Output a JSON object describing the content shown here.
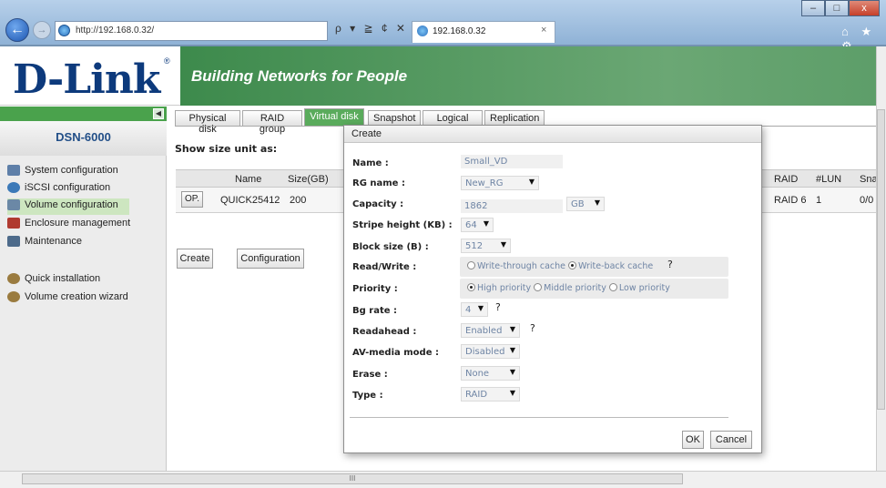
{
  "browser": {
    "address": "http://192.168.0.32/",
    "tab_title": "192.168.0.32",
    "tab_close": "×",
    "address_tools": "ρ ▾ ≧ ¢ ✕",
    "window_controls": {
      "minimize": "–",
      "maximize": "□",
      "close": "x"
    },
    "right_icons": "⌂ ★ ⚙",
    "hscroll_grip": "III"
  },
  "header": {
    "logo": "D-Link",
    "logo_reg": "®",
    "slogan": "Building Networks for People"
  },
  "sidebar": {
    "collapse": "◀",
    "model": "DSN-6000",
    "items": [
      {
        "label": "System configuration",
        "icon": "system-config-icon",
        "color": "#5e7fa8"
      },
      {
        "label": "iSCSI configuration",
        "icon": "iscsi-globe-icon",
        "color": "#3c79b8"
      },
      {
        "label": "Volume configuration",
        "icon": "volume-icon",
        "color": "#6b88a6"
      },
      {
        "label": "Enclosure management",
        "icon": "enclosure-icon",
        "color": "#b03a30"
      },
      {
        "label": "Maintenance",
        "icon": "maintenance-icon",
        "color": "#4d6a8a"
      },
      {
        "label": "Quick installation",
        "icon": "quick-install-icon",
        "color": "#9a7b3f"
      },
      {
        "label": "Volume creation wizard",
        "icon": "wizard-icon",
        "color": "#9a7b3f"
      }
    ]
  },
  "tabs": [
    "Physical disk",
    "RAID group",
    "Virtual disk",
    "Snapshot",
    "Logical unit",
    "Replication"
  ],
  "active_tab": "Virtual disk",
  "show_size_unit": "Show size unit as:",
  "table": {
    "headers": {
      "name": "Name",
      "size": "Size(GB)",
      "raid": "RAID",
      "lun": "#LUN",
      "snap": "Sna"
    },
    "row": {
      "op": "OP.",
      "name": "QUICK25412",
      "size": "200",
      "raid": "RAID 6",
      "lun": "1",
      "snap": "0/0"
    }
  },
  "page_buttons": {
    "create": "Create",
    "configuration": "Configuration"
  },
  "dialog": {
    "title": "Create",
    "fields": {
      "name": {
        "label": "Name :",
        "value": "Small_VD"
      },
      "rg_name": {
        "label": "RG name :",
        "value": "New_RG"
      },
      "capacity": {
        "label": "Capacity :",
        "value": "1862",
        "unit": "GB"
      },
      "stripe": {
        "label": "Stripe height (KB) :",
        "value": "64"
      },
      "block": {
        "label": "Block size (B) :",
        "value": "512"
      },
      "rw": {
        "label": "Read/Write :",
        "opt1": "Write-through cache",
        "opt2": "Write-back cache"
      },
      "priority": {
        "label": "Priority :",
        "opt1": "High priority",
        "opt2": "Middle priority",
        "opt3": "Low priority"
      },
      "bg_rate": {
        "label": "Bg rate :",
        "value": "4"
      },
      "readahead": {
        "label": "Readahead :",
        "value": "Enabled"
      },
      "av_media": {
        "label": "AV-media mode :",
        "value": "Disabled"
      },
      "erase": {
        "label": "Erase :",
        "value": "None"
      },
      "type": {
        "label": "Type :",
        "value": "RAID"
      }
    },
    "ok": "OK",
    "cancel": "Cancel",
    "help_glyph": "?",
    "dropdown_glyph": "▼"
  }
}
